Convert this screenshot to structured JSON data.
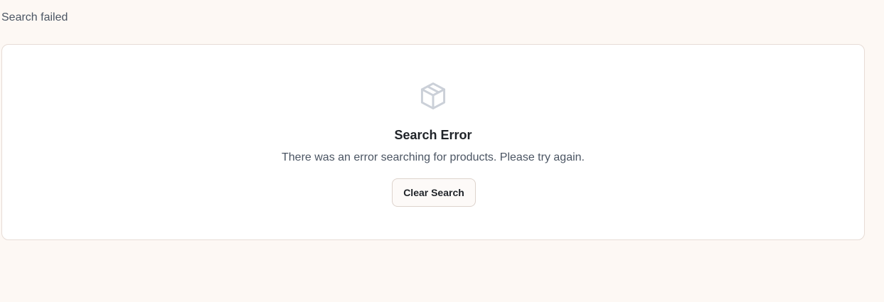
{
  "status": {
    "text": "Search failed"
  },
  "empty_state": {
    "icon": "package-icon",
    "title": "Search Error",
    "message": "There was an error searching for products. Please try again.",
    "button_label": "Clear Search"
  },
  "colors": {
    "background": "#fdf8f4",
    "card": "#ffffff",
    "border": "#e7dcd6",
    "icon": "#cbd0d8",
    "title": "#1f2328",
    "muted_text": "#4b5563"
  }
}
